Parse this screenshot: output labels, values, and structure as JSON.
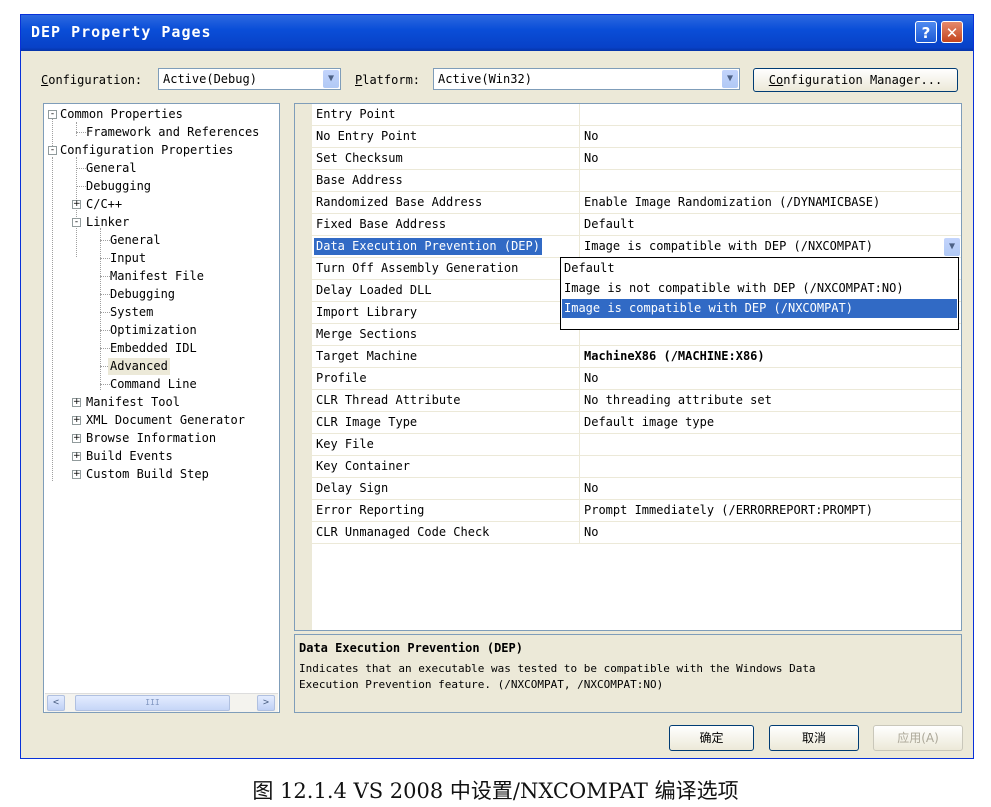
{
  "window": {
    "title": "DEP Property Pages",
    "help_glyph": "?",
    "close_glyph": "✕"
  },
  "toolbar": {
    "configuration_label_first": "C",
    "configuration_label_rest": "onfiguration:",
    "configuration_value": "Active(Debug)",
    "platform_label_first": "P",
    "platform_label_rest": "latform:",
    "platform_value": "Active(Win32)",
    "config_manager_first": "C",
    "config_manager_mid": "o",
    "config_manager_rest": "nfiguration Manager..."
  },
  "tree": [
    {
      "label": "Common Properties",
      "expander": "-"
    },
    {
      "label": "Framework and References"
    },
    {
      "label": "Configuration Properties",
      "expander": "-"
    },
    {
      "label": "General"
    },
    {
      "label": "Debugging"
    },
    {
      "label": "C/C++",
      "expander": "+"
    },
    {
      "label": "Linker",
      "expander": "-"
    },
    {
      "label": "General"
    },
    {
      "label": "Input"
    },
    {
      "label": "Manifest File"
    },
    {
      "label": "Debugging"
    },
    {
      "label": "System"
    },
    {
      "label": "Optimization"
    },
    {
      "label": "Embedded IDL"
    },
    {
      "label": "Advanced",
      "selected": true
    },
    {
      "label": "Command Line"
    },
    {
      "label": "Manifest Tool",
      "expander": "+"
    },
    {
      "label": "XML Document Generator",
      "expander": "+"
    },
    {
      "label": "Browse Information",
      "expander": "+"
    },
    {
      "label": "Build Events",
      "expander": "+"
    },
    {
      "label": "Custom Build Step",
      "expander": "+"
    }
  ],
  "tree_scroll": {
    "left": "<",
    "right": ">",
    "thumb": "III"
  },
  "properties": [
    {
      "name": "Entry Point",
      "value": ""
    },
    {
      "name": "No Entry Point",
      "value": "No"
    },
    {
      "name": "Set Checksum",
      "value": "No"
    },
    {
      "name": "Base Address",
      "value": ""
    },
    {
      "name": "Randomized Base Address",
      "value": "Enable Image Randomization (/DYNAMICBASE)"
    },
    {
      "name": "Fixed Base Address",
      "value": "Default"
    },
    {
      "name": "Data Execution Prevention (DEP)",
      "value": "Image is compatible with DEP (/NXCOMPAT)",
      "selected": true
    },
    {
      "name": "Turn Off Assembly Generation",
      "value": ""
    },
    {
      "name": "Delay Loaded DLL",
      "value": ""
    },
    {
      "name": "Import Library",
      "value": ""
    },
    {
      "name": "Merge Sections",
      "value": ""
    },
    {
      "name": "Target Machine",
      "value": "MachineX86 (/MACHINE:X86)",
      "bold": true
    },
    {
      "name": "Profile",
      "value": "No"
    },
    {
      "name": "CLR Thread Attribute",
      "value": "No threading attribute set"
    },
    {
      "name": "CLR Image Type",
      "value": "Default image type"
    },
    {
      "name": "Key File",
      "value": ""
    },
    {
      "name": "Key Container",
      "value": ""
    },
    {
      "name": "Delay Sign",
      "value": "No"
    },
    {
      "name": "Error Reporting",
      "value": "Prompt Immediately (/ERRORREPORT:PROMPT)"
    },
    {
      "name": "CLR Unmanaged Code Check",
      "value": "No"
    }
  ],
  "dropdown_options": [
    {
      "label": "Default"
    },
    {
      "label": "Image is not compatible with DEP (/NXCOMPAT:NO)"
    },
    {
      "label": "Image is compatible with DEP (/NXCOMPAT)",
      "highlighted": true
    }
  ],
  "description": {
    "title": "Data Execution Prevention (DEP)",
    "line1": "Indicates that an executable was tested to be compatible with the Windows Data",
    "line2": "Execution Prevention feature. (/NXCOMPAT, /NXCOMPAT:NO)"
  },
  "buttons": {
    "ok": "确定",
    "cancel": "取消",
    "apply": "应用(A)"
  },
  "caption": "图 12.1.4 VS  2008 中设置/NXCOMPAT 编译选项",
  "colors": {
    "selection": "#316ac5",
    "titlebar": "#0a4ed8",
    "dialog_bg": "#ece9d8"
  }
}
